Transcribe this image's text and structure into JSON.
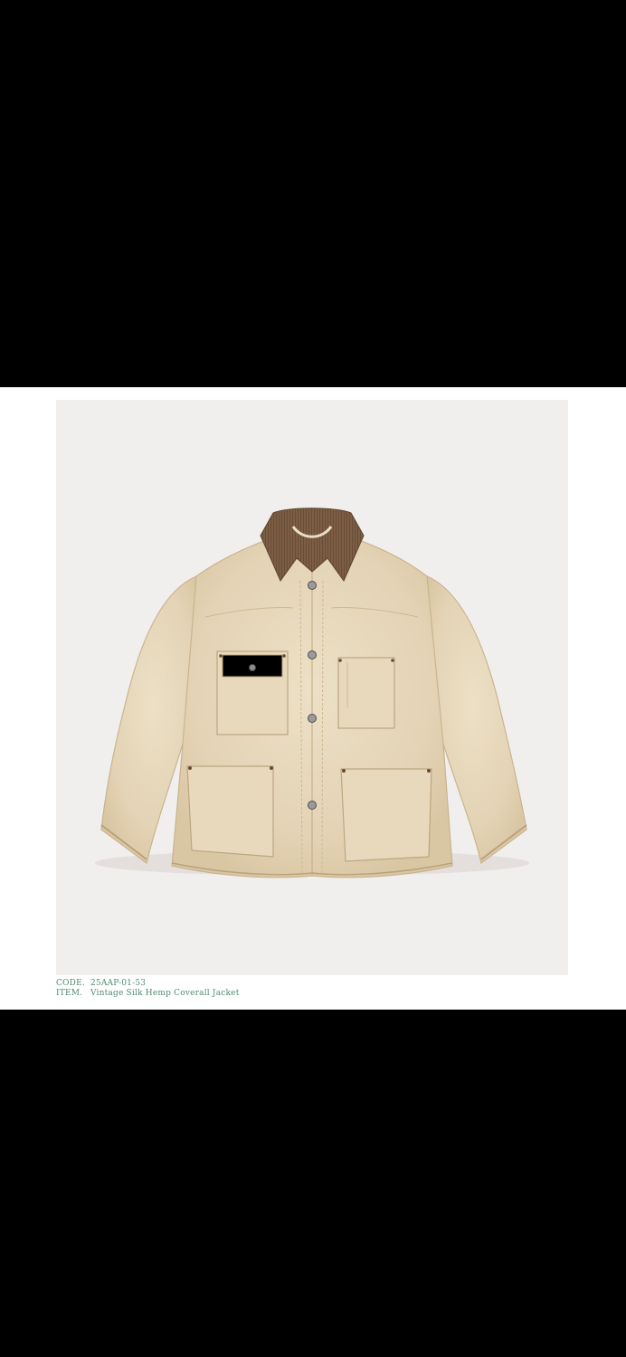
{
  "product": {
    "code_label": "CODE.",
    "code_value": "25AAP-01-53",
    "item_label": "ITEM.",
    "item_value": "Vintage Silk Hemp Coverall Jacket"
  },
  "colors": {
    "background": "#000000",
    "card": "#ffffff",
    "photo_backdrop": "#f1efee",
    "caption_text": "#4f8a6e",
    "jacket_body": "#e6d6ba",
    "jacket_collar": "#7c5e45"
  }
}
